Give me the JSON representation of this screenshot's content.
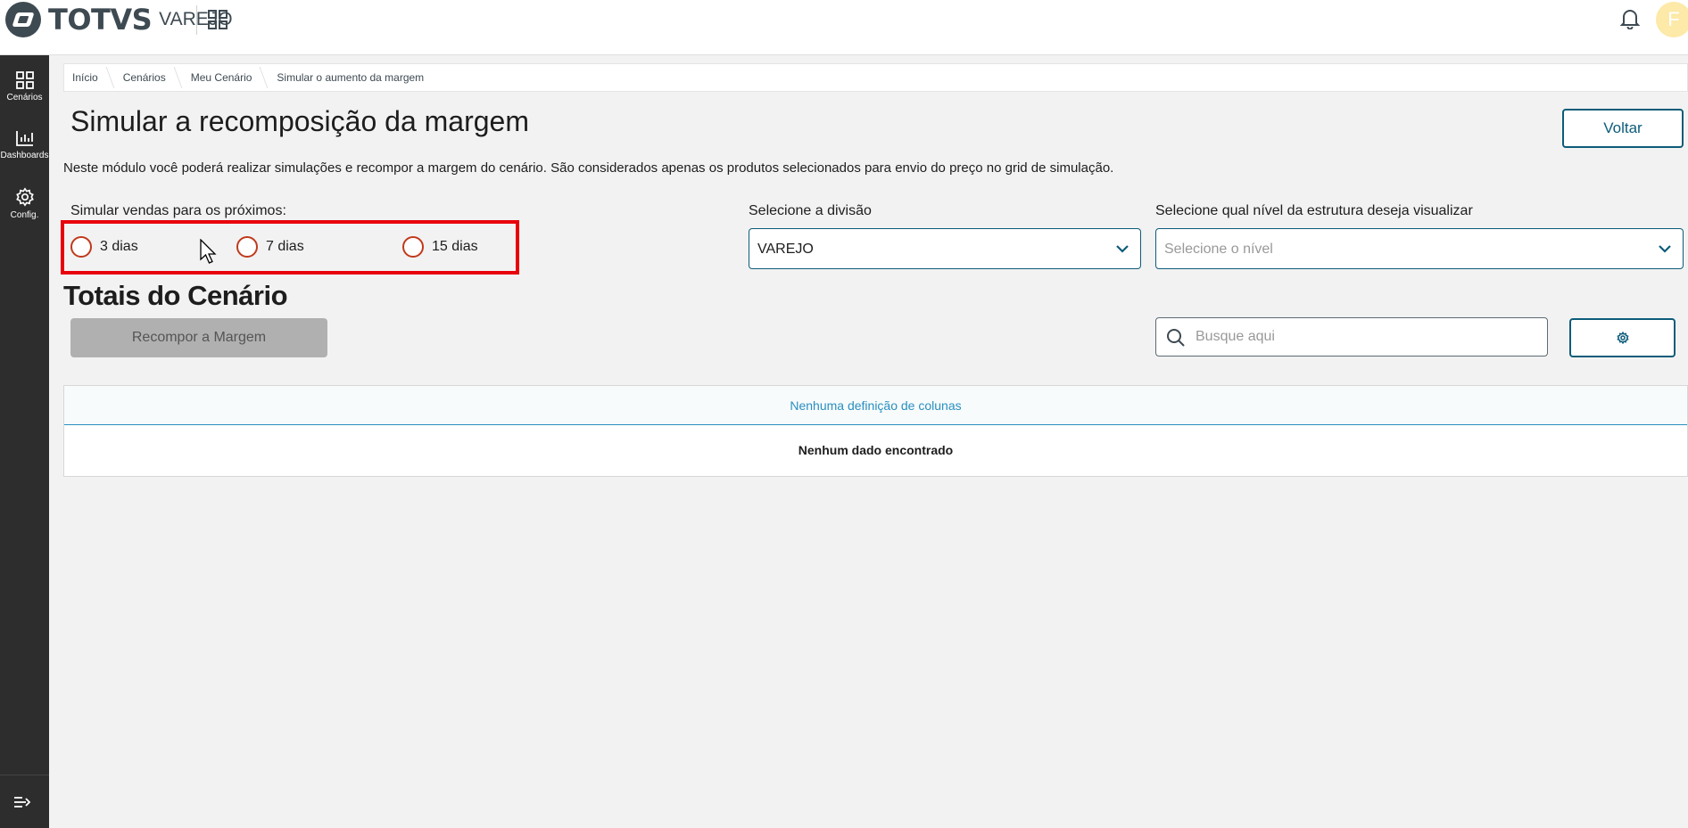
{
  "header": {
    "brand": "TOTVS",
    "product": "VAREJO",
    "user_initial": "F"
  },
  "sidebar": {
    "items": [
      {
        "label": "Cenários",
        "icon": "grid-icon"
      },
      {
        "label": "Dashboards",
        "icon": "bar-chart-icon"
      },
      {
        "label": "Config.",
        "icon": "gear-icon"
      }
    ]
  },
  "breadcrumb": [
    "Início",
    "Cenários",
    "Meu Cenário",
    "Simular o aumento da margem"
  ],
  "page": {
    "title": "Simular a recomposição da margem",
    "back_label": "Voltar",
    "description": "Neste módulo você poderá realizar simulações e recompor a margem do cenário. São considerados apenas os produtos selecionados para envio do preço no grid de simulação."
  },
  "simulation": {
    "label": "Simular vendas para os próximos:",
    "options": [
      "3 dias",
      "7 dias",
      "15 dias"
    ]
  },
  "division": {
    "label": "Selecione a divisão",
    "value": "VAREJO"
  },
  "level": {
    "label": "Selecione qual nível da estrutura deseja visualizar",
    "placeholder": "Selecione o nível"
  },
  "totals": {
    "title": "Totais do Cenário",
    "recompor_label": "Recompor a Margem",
    "search_placeholder": "Busque aqui"
  },
  "grid": {
    "no_columns": "Nenhuma definição de colunas",
    "no_data": "Nenhum dado encontrado"
  },
  "colors": {
    "primary": "#0c5c7a",
    "highlight": "#e8000b",
    "sidebar": "#2d2d2d"
  }
}
